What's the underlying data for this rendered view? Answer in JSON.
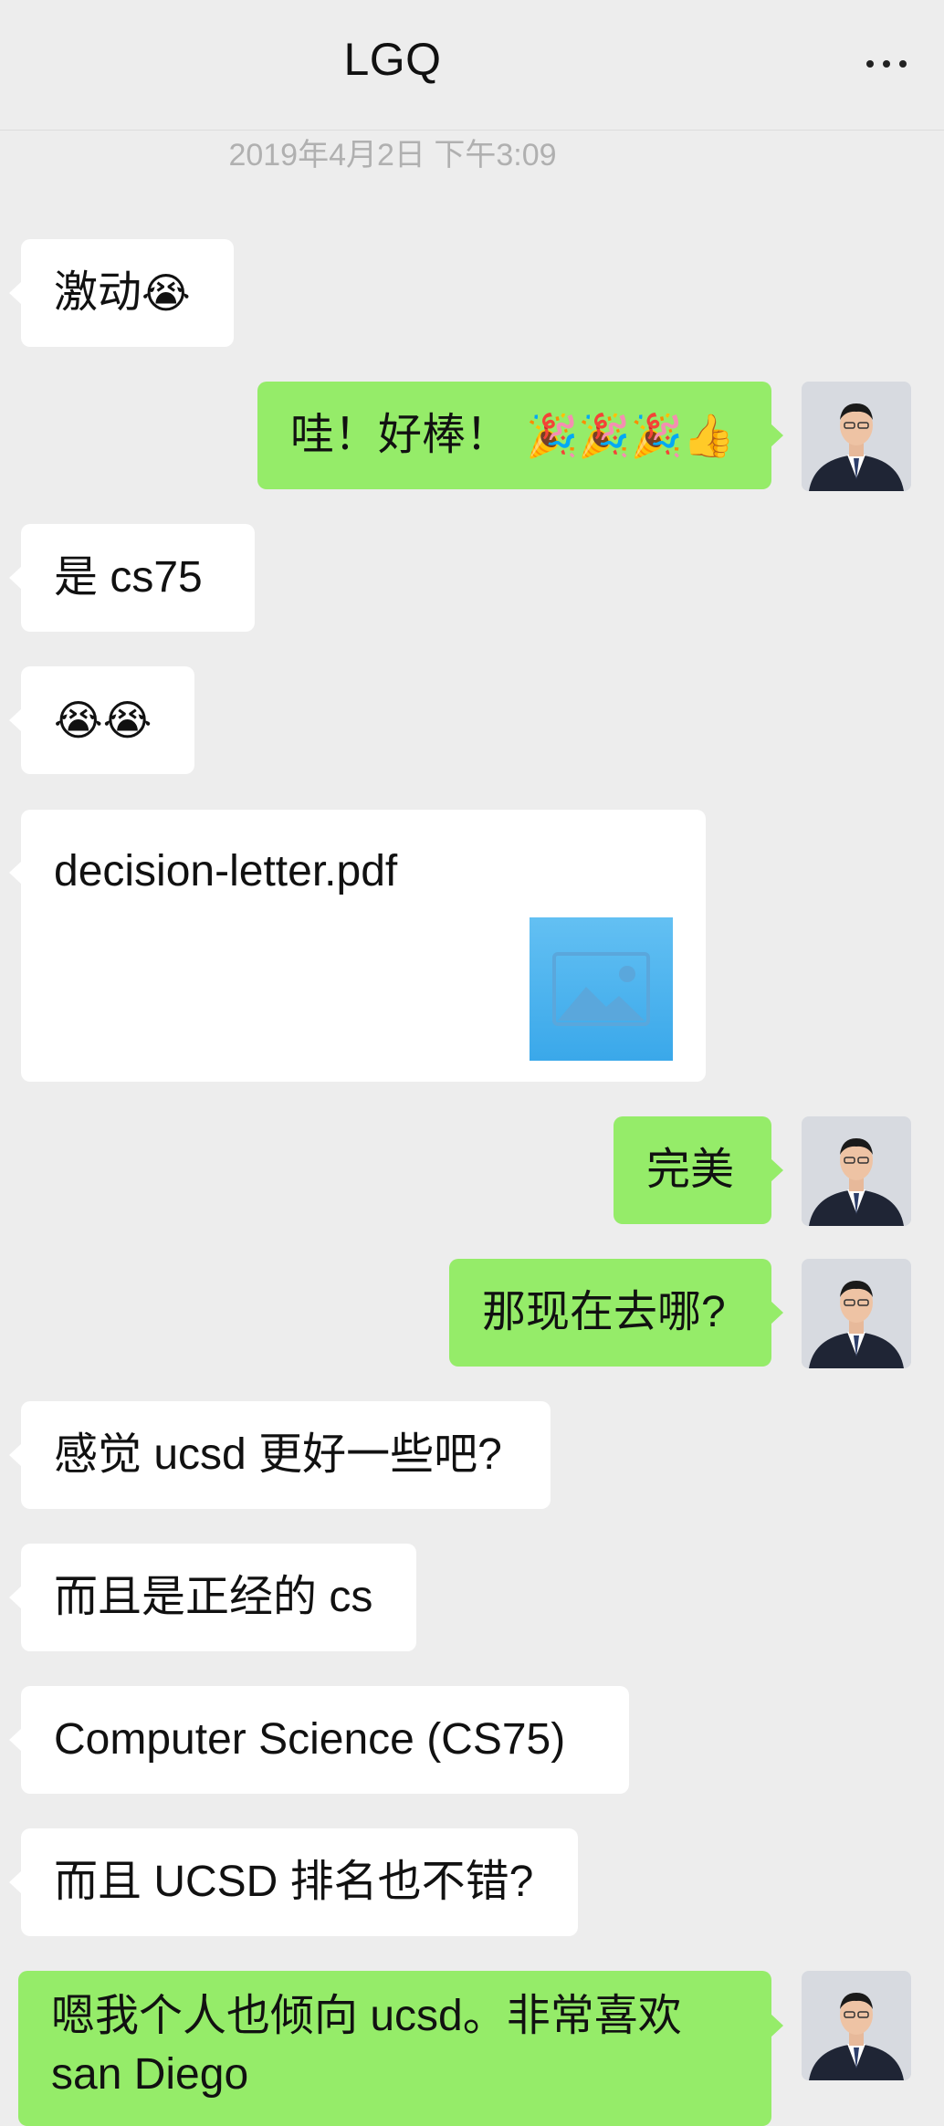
{
  "header": {
    "title": "LGQ",
    "more_icon": "more-dots-icon"
  },
  "timestamp": "2019年4月2日 下午3:09",
  "messages": [
    {
      "side": "in",
      "text": "激动",
      "emoji": "😭"
    },
    {
      "side": "out",
      "text": "哇！好棒！",
      "emoji": "🎉🎉🎉👍"
    },
    {
      "side": "in",
      "text": "是 cs75"
    },
    {
      "side": "in",
      "text": "",
      "emoji": "😭😭"
    },
    {
      "side": "in",
      "type": "file",
      "text": "decision-letter.pdf",
      "icon": "image-file-icon"
    },
    {
      "side": "out",
      "text": "完美"
    },
    {
      "side": "out",
      "text": "那现在去哪?"
    },
    {
      "side": "in",
      "text": "感觉 ucsd 更好一些吧?"
    },
    {
      "side": "in",
      "text": "而且是正经的 cs"
    },
    {
      "side": "in",
      "text": "Computer Science (CS75)"
    },
    {
      "side": "in",
      "text": "而且 UCSD 排名也不错?"
    },
    {
      "side": "out",
      "text_line1": "嗯我个人也倾向 ucsd。非常喜欢",
      "text_line2": "san Diego"
    }
  ],
  "colors": {
    "background": "#ededed",
    "incoming_bubble": "#ffffff",
    "outgoing_bubble": "#95ec69",
    "timestamp": "#b0b0b0",
    "file_icon": "#4db3ee"
  }
}
